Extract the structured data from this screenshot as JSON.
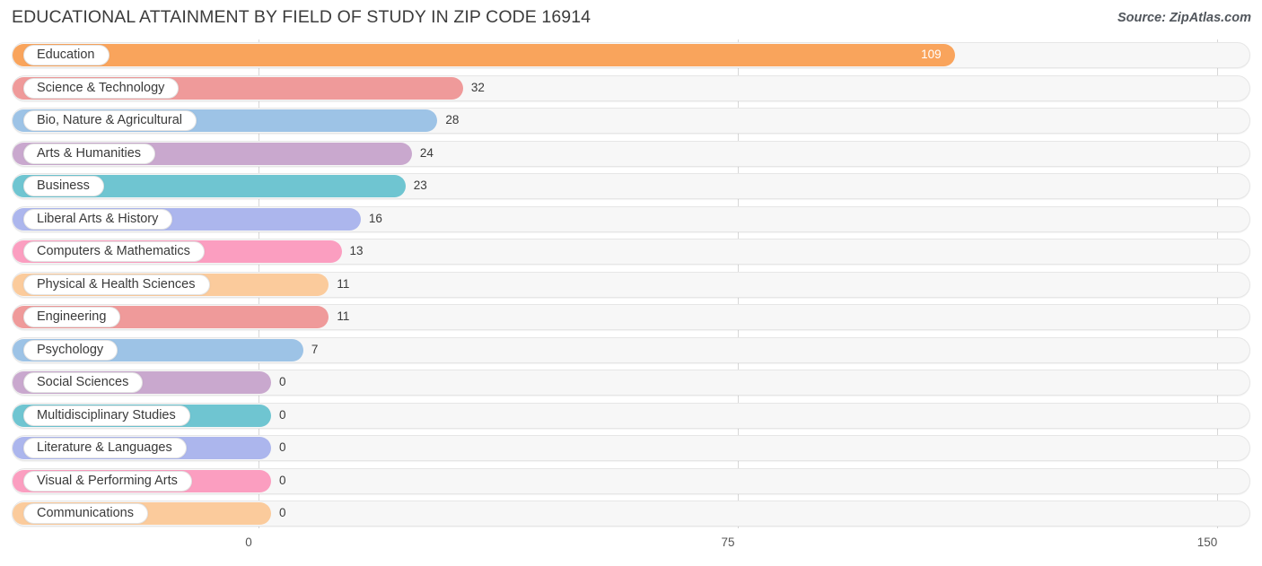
{
  "header": {
    "title": "EDUCATIONAL ATTAINMENT BY FIELD OF STUDY IN ZIP CODE 16914",
    "source": "Source: ZipAtlas.com"
  },
  "chart_data": {
    "type": "bar",
    "orientation": "horizontal",
    "title": "EDUCATIONAL ATTAINMENT BY FIELD OF STUDY IN ZIP CODE 16914",
    "xlabel": "",
    "ylabel": "",
    "xlim": [
      0,
      150
    ],
    "ticks": [
      "0",
      "75",
      "150"
    ],
    "tick_values": [
      0,
      75,
      150
    ],
    "grid": true,
    "legend": "none",
    "categories": [
      "Education",
      "Science & Technology",
      "Bio, Nature & Agricultural",
      "Arts & Humanities",
      "Business",
      "Liberal Arts & History",
      "Computers & Mathematics",
      "Physical & Health Sciences",
      "Engineering",
      "Psychology",
      "Social Sciences",
      "Multidisciplinary Studies",
      "Literature & Languages",
      "Visual & Performing Arts",
      "Communications"
    ],
    "values": [
      109,
      32,
      28,
      24,
      23,
      16,
      13,
      11,
      11,
      7,
      0,
      0,
      0,
      0,
      0
    ],
    "value_labels": [
      "109",
      "32",
      "28",
      "24",
      "23",
      "16",
      "13",
      "11",
      "11",
      "7",
      "0",
      "0",
      "0",
      "0",
      "0"
    ],
    "colors": [
      "#f9a45c",
      "#ef9a9a",
      "#9dc3e6",
      "#c9a8ce",
      "#6fc5d1",
      "#acb6ed",
      "#fb9ec0",
      "#fbcb9c",
      "#ef9a9a",
      "#9dc3e6",
      "#c9a8ce",
      "#6fc5d1",
      "#acb6ed",
      "#fb9ec0",
      "#fbcb9c"
    ]
  },
  "theme": {
    "track_bg": "#f7f7f7",
    "track_border": "#e6e6e6",
    "gridline": "#d8d8d8",
    "text": "#3a3a3a",
    "title_color": "#3c3c3c"
  }
}
